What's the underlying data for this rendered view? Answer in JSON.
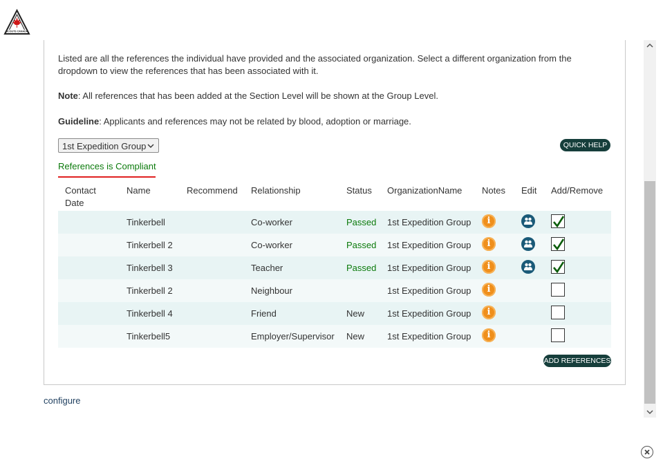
{
  "intro": {
    "paragraph": "Listed are all the references the individual have provided and the associated organization. Select a different organization from the dropdown to view the references that has been associated with it.",
    "note_label": "Note",
    "note_text": ": All references that has been added at the Section Level will be shown at the Group Level.",
    "guideline_label": "Guideline",
    "guideline_text": ": Applicants and references may not be related by blood, adoption or marriage."
  },
  "org_select": {
    "selected": "1st Expedition Group"
  },
  "quick_help_label": "QUICK HELP",
  "compliance_status": "References is Compliant",
  "table": {
    "headers": {
      "contact_date": "Contact Date",
      "name": "Name",
      "recommend": "Recommend",
      "relationship": "Relationship",
      "status": "Status",
      "organization": "OrganizationName",
      "notes": "Notes",
      "edit": "Edit",
      "add_remove": "Add/Remove"
    },
    "rows": [
      {
        "contact_date": "",
        "name": "Tinkerbell",
        "recommend": "",
        "relationship": "Co-worker",
        "status": "Passed",
        "organization": "1st Expedition Group",
        "editable": true,
        "checked": true
      },
      {
        "contact_date": "",
        "name": "Tinkerbell 2",
        "recommend": "",
        "relationship": "Co-worker",
        "status": "Passed",
        "organization": "1st Expedition Group",
        "editable": true,
        "checked": true
      },
      {
        "contact_date": "",
        "name": "Tinkerbell 3",
        "recommend": "",
        "relationship": "Teacher",
        "status": "Passed",
        "organization": "1st Expedition Group",
        "editable": true,
        "checked": true
      },
      {
        "contact_date": "",
        "name": "Tinkerbell 2",
        "recommend": "",
        "relationship": "Neighbour",
        "status": "",
        "organization": "1st Expedition Group",
        "editable": false,
        "checked": false
      },
      {
        "contact_date": "",
        "name": "Tinkerbell 4",
        "recommend": "",
        "relationship": "Friend",
        "status": "New",
        "organization": "1st Expedition Group",
        "editable": false,
        "checked": false
      },
      {
        "contact_date": "",
        "name": "Tinkerbell5",
        "recommend": "",
        "relationship": "Employer/Supervisor",
        "status": "New",
        "organization": "1st Expedition Group",
        "editable": false,
        "checked": false
      }
    ]
  },
  "add_references_label": "ADD REFERENCES",
  "configure_link": "configure",
  "colors": {
    "button_bg": "#163e3b",
    "compliant_text": "#0b7a0b",
    "compliant_underline": "#e02020",
    "notes_icon": "#ef8f1c",
    "edit_icon": "#1a5a78",
    "row_alt": "#e8f4f4"
  },
  "icons": {
    "logo": "scouts-canada-logo",
    "notes": "info-icon",
    "edit": "people-icon",
    "close": "close-icon"
  }
}
